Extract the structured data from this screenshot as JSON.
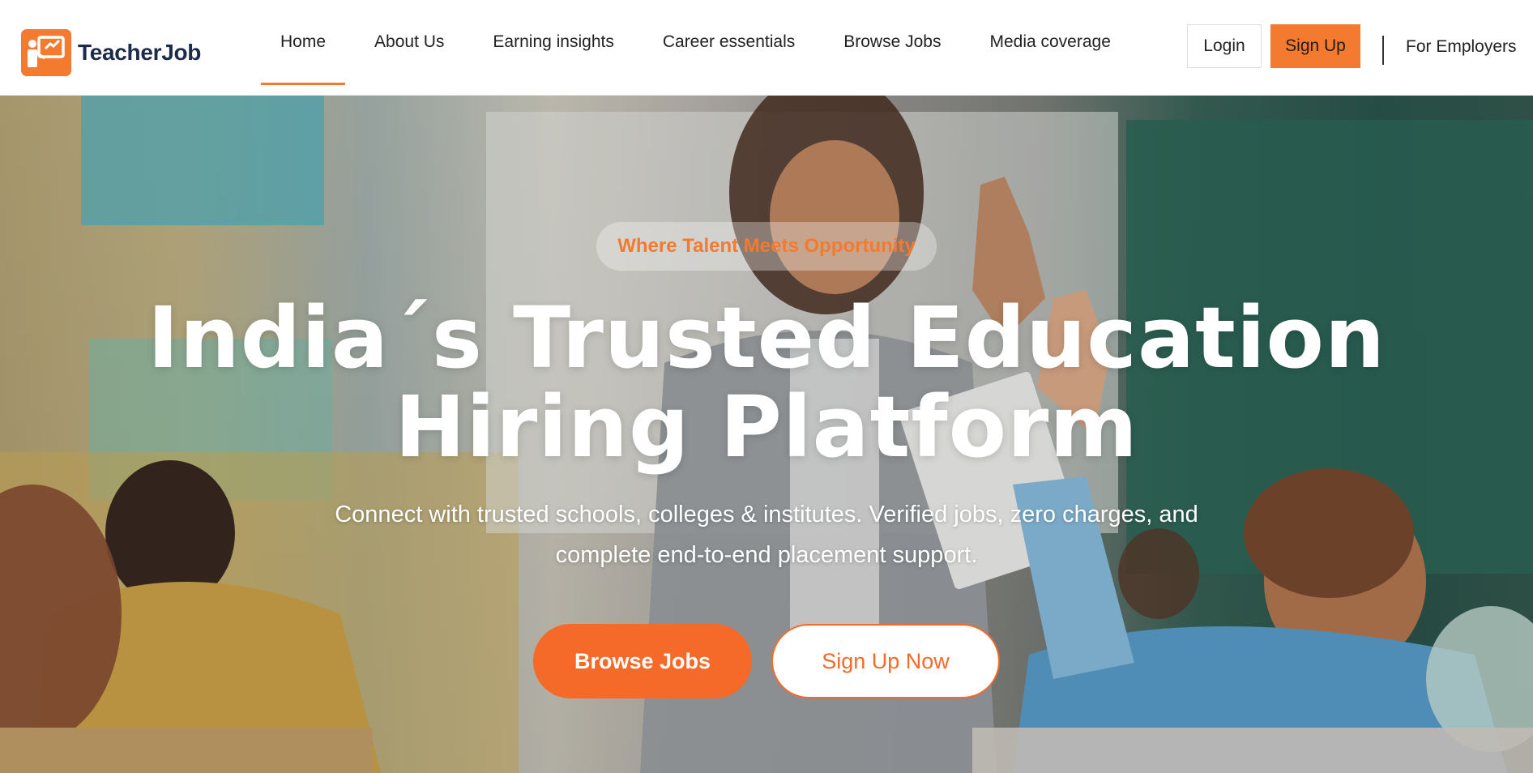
{
  "brand": {
    "name": "TeacherJob",
    "accent_color": "#f47a2f",
    "text_color": "#1d2b4a",
    "logo_icon": "teacher-at-board-icon"
  },
  "nav": {
    "items": [
      {
        "label": "Home",
        "active": true
      },
      {
        "label": "About Us",
        "active": false
      },
      {
        "label": "Earning insights",
        "active": false
      },
      {
        "label": "Career essentials",
        "active": false
      },
      {
        "label": "Browse Jobs",
        "active": false
      },
      {
        "label": "Media coverage",
        "active": false
      }
    ]
  },
  "header_actions": {
    "login_label": "Login",
    "signup_label": "Sign Up",
    "employers_label": "For Employers"
  },
  "hero": {
    "tagline": "Where Talent Meets Opportunity",
    "headline": "India´s Trusted Education Hiring Platform",
    "subtext": "Connect with trusted schools, colleges & institutes. Verified jobs, zero charges, and complete end-to-end placement support.",
    "primary_cta": "Browse Jobs",
    "secondary_cta": "Sign Up Now",
    "cta_color": "#f56a28"
  }
}
